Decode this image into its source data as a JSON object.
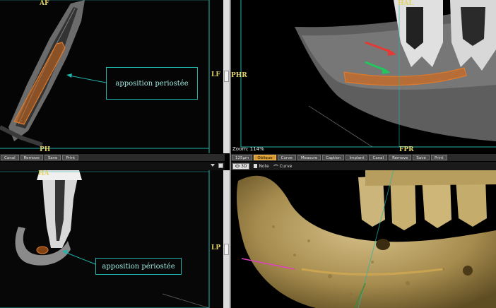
{
  "panes": {
    "top_left": {
      "top_label": "AF",
      "bottom_label": "PH",
      "side_label": "LF",
      "annotation": "apposition periostée"
    },
    "top_right": {
      "top_label": "HAL",
      "side_label": "PHR",
      "bottom_label": "FPR",
      "zoom_text": "Zoom: 114%"
    },
    "bottom_left": {
      "top_label": "HA",
      "annotation": "apposition périostée",
      "side_label": "LP"
    },
    "bottom_right": {}
  },
  "toolbars": {
    "left": {
      "buttons": [
        "Canal",
        "Remove",
        "Save",
        "Print"
      ]
    },
    "right": {
      "buttons": [
        "125µm",
        "Oblique",
        "Curve",
        "Measure",
        "Caption",
        "Implant",
        "Canal",
        "Remove",
        "Save",
        "Print"
      ],
      "active": "Oblique"
    },
    "view3d": {
      "items": [
        "3D",
        "Note",
        "Curve"
      ]
    }
  },
  "colors": {
    "annotation": "#1fb5ac",
    "orientation_label": "#e2d36a",
    "active_button": "#d89a2e",
    "canal_overlay": "#d2691e",
    "red_arrow": "#e53935",
    "green_arrow": "#22c55e",
    "bone_3d": "#b8a060"
  },
  "icons": {
    "nav_arrow": "triangle-down-icon",
    "view3d": "eye-icon"
  }
}
